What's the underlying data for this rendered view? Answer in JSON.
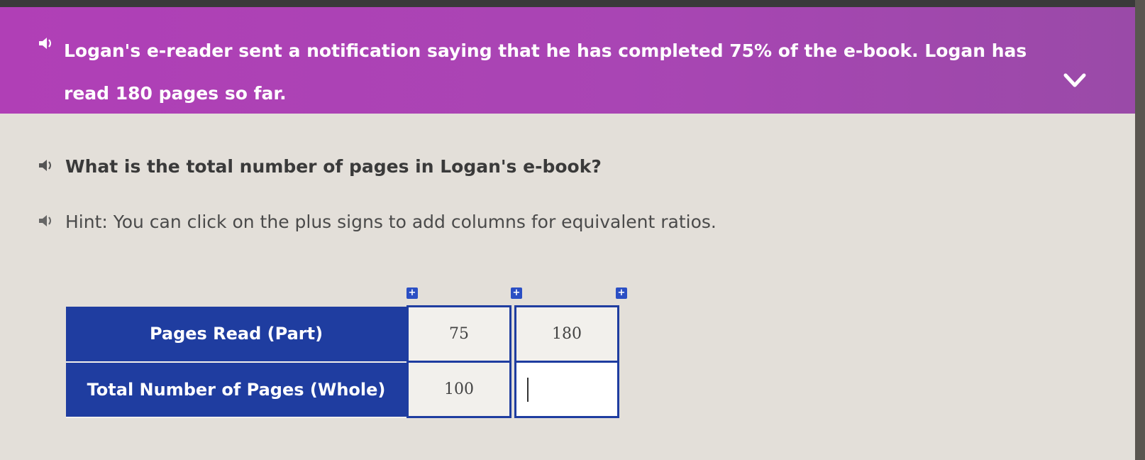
{
  "banner": {
    "text": "Logan's e-reader sent a notification saying that he has completed 75% of the e-book. Logan has read 180 pages so far."
  },
  "question": {
    "text": "What is the total number of pages in Logan's e-book?"
  },
  "hint": {
    "text": "Hint: You can click on the plus signs to add columns for equivalent ratios."
  },
  "table": {
    "rows": [
      {
        "label": "Pages Read (Part)",
        "values": [
          "75",
          "180"
        ]
      },
      {
        "label": "Total Number of Pages (Whole)",
        "values": [
          "100",
          ""
        ]
      }
    ],
    "plus_label": "+"
  },
  "icons": {
    "speaker": "speaker-icon",
    "chevron": "chevron-down-icon"
  },
  "colors": {
    "banner": "#b03fb6",
    "table_header": "#1f3da0",
    "background": "#e3dfd9"
  }
}
